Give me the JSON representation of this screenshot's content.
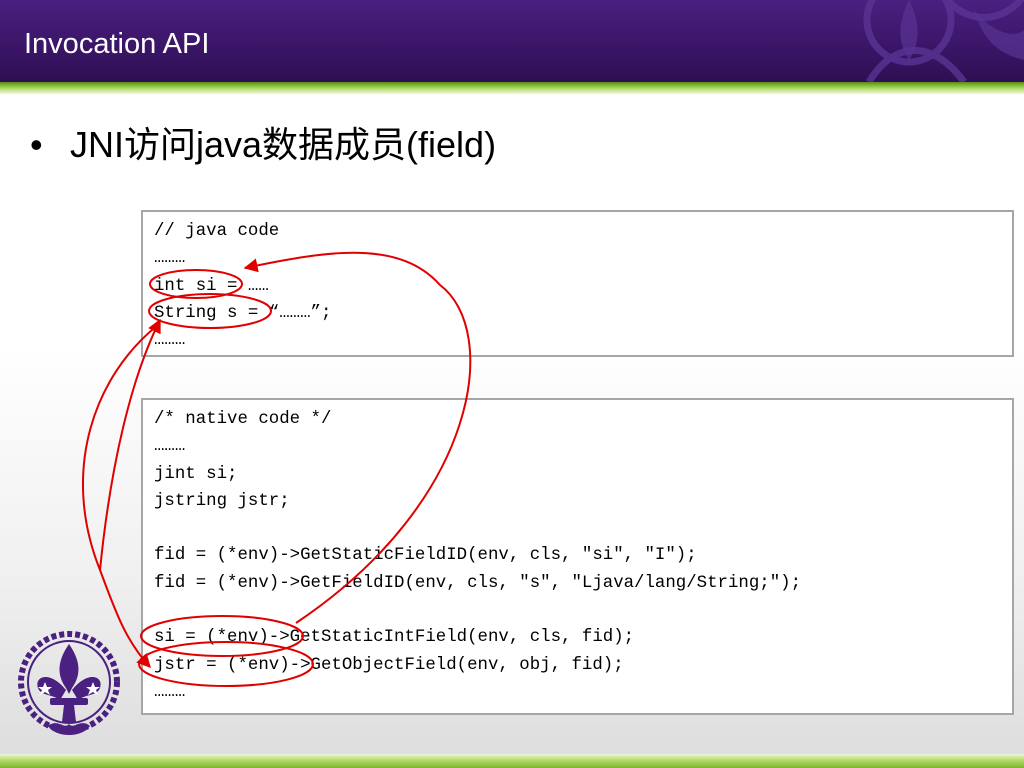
{
  "slide": {
    "title": "Invocation API",
    "bullet": "JNI访问java数据成员(field)"
  },
  "java_code": {
    "lines": [
      "// java code",
      "………",
      "int si = ……",
      "String s = “………”;",
      "………"
    ]
  },
  "native_code": {
    "lines": [
      "/* native code */",
      "………",
      "jint si;",
      "jstring jstr;",
      "",
      "fid = (*env)->GetStaticFieldID(env, cls, \"si\", \"I\");",
      "fid = (*env)->GetFieldID(env, cls, \"s\", \"Ljava/lang/String;\");",
      "",
      "si = (*env)->GetStaticIntField(env, cls, fid);",
      "jstr = (*env)->GetObjectField(env, obj, fid);",
      "………"
    ]
  },
  "colors": {
    "header": "#3a1566",
    "accent_green": "#8cc63f",
    "annotation_red": "#e00000",
    "logo_purple": "#4a2080"
  },
  "icons": {
    "logo": "fleur-de-lis-emblem-icon",
    "header_decoration": "fleur-de-lis-watermark-icon"
  }
}
